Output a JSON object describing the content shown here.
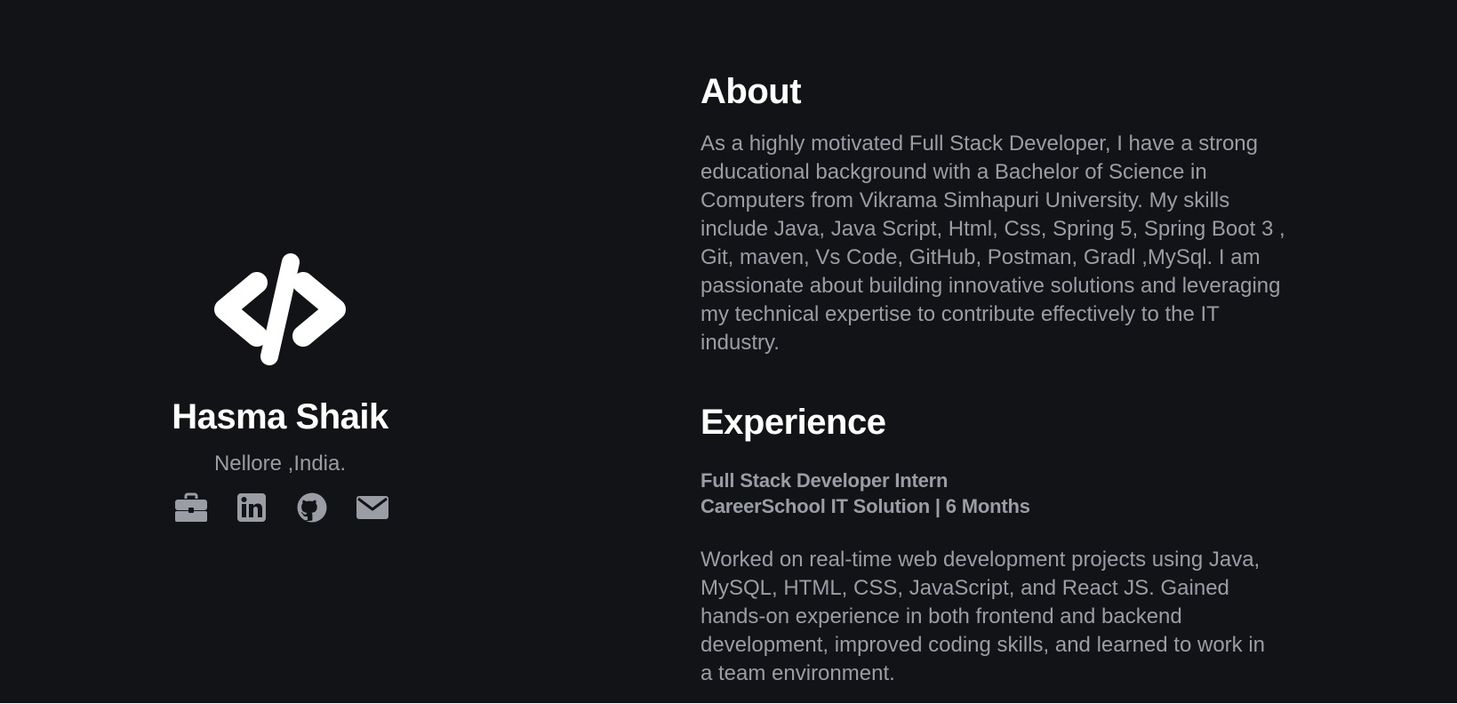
{
  "profile": {
    "logo_icon": "code-icon",
    "name": "Hasma Shaik",
    "location": "Nellore ,India.",
    "socials": [
      {
        "icon": "briefcase-icon"
      },
      {
        "icon": "linkedin-icon"
      },
      {
        "icon": "github-icon"
      },
      {
        "icon": "envelope-icon"
      }
    ]
  },
  "about": {
    "title": "About",
    "text": "As a highly motivated Full Stack Developer, I have a strong educational background with a Bachelor of Science in Computers from Vikrama Simhapuri University. My skills include Java, Java Script, Html, Css, Spring 5, Spring Boot 3 , Git, maven, Vs Code, GitHub, Postman, Gradl ,MySql. I am passionate about building innovative solutions and leveraging my technical expertise to contribute effectively to the IT industry."
  },
  "experience": {
    "title": "Experience",
    "role": "Full Stack Developer Intern",
    "company_duration": "CareerSchool IT Solution | 6 Months",
    "description": "Worked on real-time web development projects using Java, MySQL, HTML, CSS, JavaScript, and React JS. Gained hands-on experience in both frontend and backend development, improved coding skills, and learned to work in a team environment."
  },
  "colors": {
    "background": "#121316",
    "heading": "#ffffff",
    "body_text": "#9a9da3",
    "icon": "#9a9da3"
  }
}
